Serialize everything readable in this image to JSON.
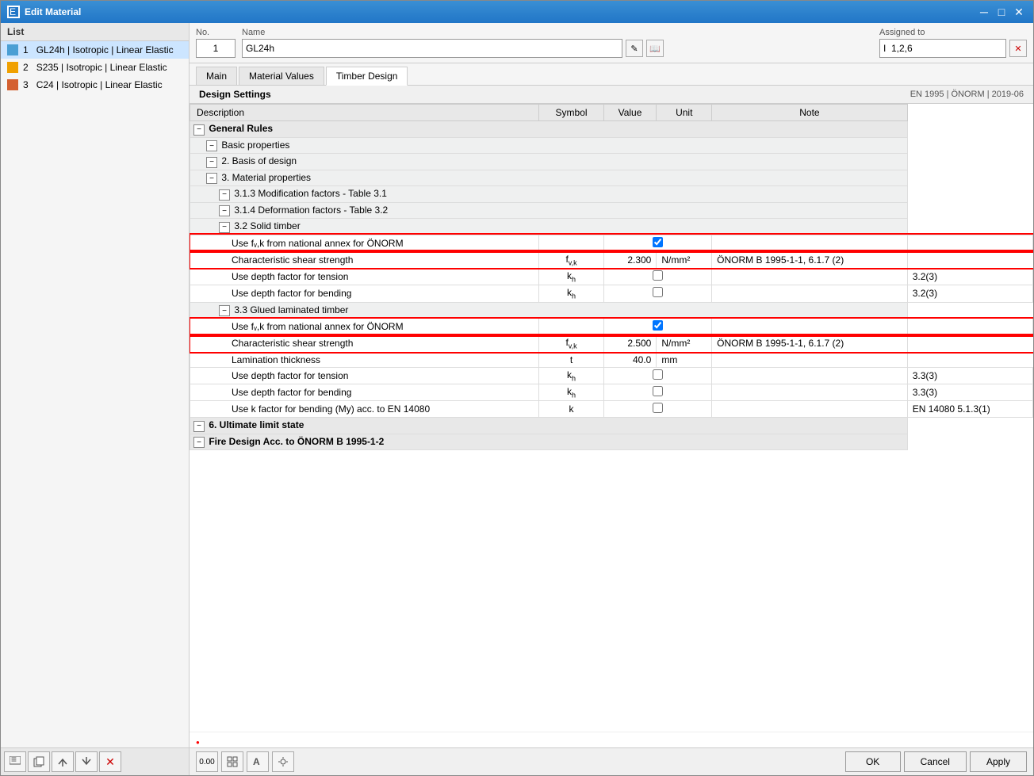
{
  "window": {
    "title": "Edit Material"
  },
  "list": {
    "header": "List",
    "items": [
      {
        "id": 1,
        "color": "#4a9fd4",
        "text": "GL24h | Isotropic | Linear Elastic",
        "selected": true
      },
      {
        "id": 2,
        "color": "#f0a000",
        "text": "S235 | Isotropic | Linear Elastic",
        "selected": false
      },
      {
        "id": 3,
        "color": "#d46030",
        "text": "C24 | Isotropic | Linear Elastic",
        "selected": false
      }
    ]
  },
  "header": {
    "no_label": "No.",
    "no_value": "1",
    "name_label": "Name",
    "name_value": "GL24h",
    "assigned_label": "Assigned to",
    "assigned_value": "I  1,2,6"
  },
  "tabs": [
    {
      "id": "main",
      "label": "Main"
    },
    {
      "id": "material_values",
      "label": "Material Values"
    },
    {
      "id": "timber_design",
      "label": "Timber Design",
      "active": true
    }
  ],
  "design_settings": {
    "title": "Design Settings",
    "info": "EN 1995 | ÖNORM | 2019-06"
  },
  "table": {
    "columns": [
      "Description",
      "Symbol",
      "Value",
      "Unit",
      "Note"
    ],
    "rows": [
      {
        "type": "group",
        "level": 0,
        "expandable": true,
        "desc": "General Rules"
      },
      {
        "type": "subgroup",
        "level": 1,
        "expandable": true,
        "desc": "Basic properties"
      },
      {
        "type": "subgroup",
        "level": 1,
        "expandable": true,
        "desc": "2. Basis of design"
      },
      {
        "type": "subgroup",
        "level": 1,
        "expandable": true,
        "desc": "3. Material properties"
      },
      {
        "type": "subgroup",
        "level": 2,
        "expandable": true,
        "desc": "3.1.3 Modification factors - Table 3.1"
      },
      {
        "type": "subgroup",
        "level": 2,
        "expandable": true,
        "desc": "3.1.4 Deformation factors - Table 3.2"
      },
      {
        "type": "subgroup",
        "level": 2,
        "expandable": true,
        "desc": "3.2 Solid timber"
      },
      {
        "type": "data",
        "level": 3,
        "desc": "Use fᵥ,k from national annex for ÖNORM",
        "symbol": "",
        "value": "",
        "unit": "",
        "note": "",
        "checkbox": true,
        "checked": true,
        "highlight": true
      },
      {
        "type": "data",
        "level": 3,
        "desc": "Characteristic shear strength",
        "symbol": "fᵥ,k",
        "value": "2.300",
        "unit": "N/mm²",
        "note": "ÖNORM B 1995-1-1, 6.1.7 (2)",
        "checkbox": false,
        "checked": false,
        "highlight": true
      },
      {
        "type": "data",
        "level": 3,
        "desc": "Use depth factor for tension",
        "symbol": "kh",
        "value": "",
        "unit": "",
        "note": "3.2(3)",
        "checkbox": true,
        "checked": false
      },
      {
        "type": "data",
        "level": 3,
        "desc": "Use depth factor for bending",
        "symbol": "kh",
        "value": "",
        "unit": "",
        "note": "3.2(3)",
        "checkbox": true,
        "checked": false
      },
      {
        "type": "subgroup",
        "level": 2,
        "expandable": true,
        "desc": "3.3 Glued laminated timber"
      },
      {
        "type": "data",
        "level": 3,
        "desc": "Use fᵥ,k from national annex for ÖNORM",
        "symbol": "",
        "value": "",
        "unit": "",
        "note": "",
        "checkbox": true,
        "checked": true,
        "highlight": true
      },
      {
        "type": "data",
        "level": 3,
        "desc": "Characteristic shear strength",
        "symbol": "fᵥ,k",
        "value": "2.500",
        "unit": "N/mm²",
        "note": "ÖNORM B 1995-1-1, 6.1.7 (2)",
        "checkbox": false,
        "checked": false,
        "highlight": true
      },
      {
        "type": "data",
        "level": 3,
        "desc": "Lamination thickness",
        "symbol": "t",
        "value": "40.0",
        "unit": "mm",
        "note": "",
        "checkbox": false,
        "checked": false
      },
      {
        "type": "data",
        "level": 3,
        "desc": "Use depth factor for tension",
        "symbol": "kh",
        "value": "",
        "unit": "",
        "note": "3.3(3)",
        "checkbox": true,
        "checked": false
      },
      {
        "type": "data",
        "level": 3,
        "desc": "Use depth factor for bending",
        "symbol": "kh",
        "value": "",
        "unit": "",
        "note": "3.3(3)",
        "checkbox": true,
        "checked": false
      },
      {
        "type": "data",
        "level": 3,
        "desc": "Use k factor for bending (My) acc. to EN 14080",
        "symbol": "k",
        "value": "",
        "unit": "",
        "note": "EN 14080 5.1.3(1)",
        "checkbox": true,
        "checked": false
      },
      {
        "type": "group",
        "level": 0,
        "expandable": true,
        "desc": "6. Ultimate limit state"
      },
      {
        "type": "group",
        "level": 0,
        "expandable": true,
        "desc": "Fire Design Acc. to ÖNORM B 1995-1-2"
      }
    ]
  },
  "footer_buttons": {
    "ok": "OK",
    "cancel": "Cancel",
    "apply": "Apply"
  }
}
